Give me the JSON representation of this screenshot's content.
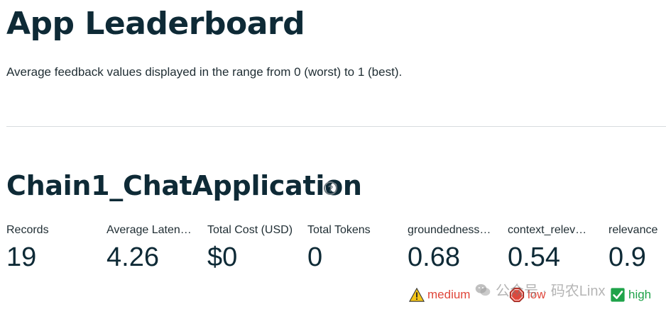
{
  "header": {
    "title": "App Leaderboard",
    "subtitle": "Average feedback values displayed in the range from 0 (worst) to 1 (best)."
  },
  "app": {
    "name": "Chain1_ChatApplication",
    "help_glyph": "?"
  },
  "metrics": [
    {
      "label": "Records",
      "value": "19"
    },
    {
      "label": "Average Laten…",
      "value": "4.26"
    },
    {
      "label": "Total Cost (USD)",
      "value": "$0"
    },
    {
      "label": "Total Tokens",
      "value": "0"
    },
    {
      "label": "groundedness…",
      "value": "0.68",
      "status": {
        "text": "medium",
        "icon": "warning-icon",
        "color": "#e0463a"
      }
    },
    {
      "label": "context_relev…",
      "value": "0.54",
      "status": {
        "text": "low",
        "icon": "stop-sign-icon",
        "color": "#e0463a"
      }
    },
    {
      "label": "relevance",
      "value": "0.9",
      "status": {
        "text": "high",
        "icon": "check-box-icon",
        "color": "#1fa34a"
      }
    }
  ],
  "watermark": {
    "text": "公众号 · 码农Linx"
  },
  "colors": {
    "title": "#0e2a36",
    "warning_yellow": "#f5c518",
    "stop_red": "#e0463a",
    "check_green": "#1fa34a"
  }
}
